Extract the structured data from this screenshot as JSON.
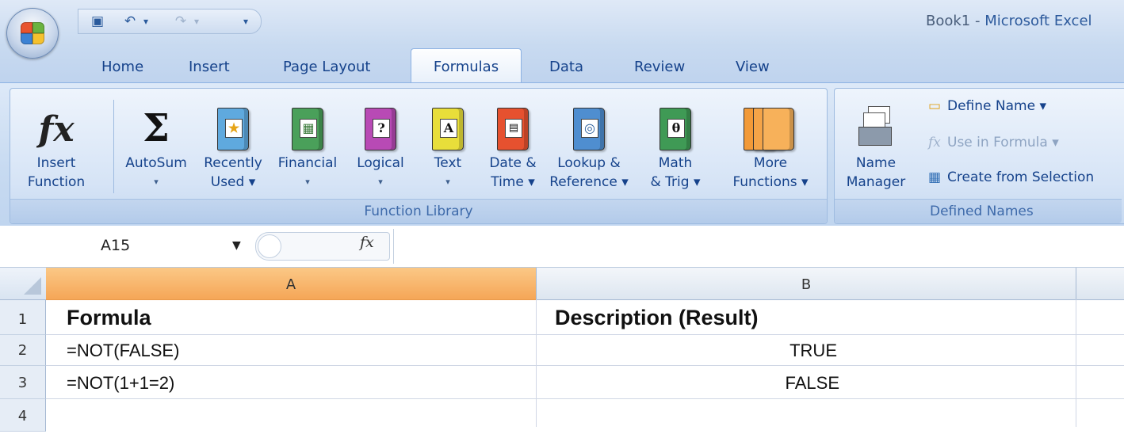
{
  "window": {
    "document": "Book1",
    "separator": " - ",
    "app": "Microsoft Excel"
  },
  "quick_access": {
    "icons": [
      "save-icon",
      "undo-icon",
      "redo-icon",
      "customize-icon"
    ],
    "glyphs": {
      "save": "▣",
      "undo": "↶",
      "undo_drop": "▾",
      "redo": "↷",
      "redo_drop": "▾",
      "customize": "₹"
    }
  },
  "tabs": [
    {
      "label": "Home"
    },
    {
      "label": "Insert"
    },
    {
      "label": "Page Layout"
    },
    {
      "label": "Formulas",
      "active": true
    },
    {
      "label": "Data"
    },
    {
      "label": "Review"
    },
    {
      "label": "View"
    }
  ],
  "ribbon": {
    "insert_function": {
      "line1": "Insert",
      "line2": "Function",
      "glyph": "fx"
    },
    "function_library": {
      "label": "Function Library",
      "autosum": {
        "line1": "AutoSum",
        "line2": "▾",
        "glyph": "Σ"
      },
      "recently_used": {
        "line1": "Recently",
        "line2": "Used ▾",
        "glyph": "★",
        "color": "#5fa9de"
      },
      "financial": {
        "line1": "Financial",
        "line2": "▾",
        "glyph": "▦",
        "color": "#4aa05a"
      },
      "logical": {
        "line1": "Logical",
        "line2": "▾",
        "glyph": "?",
        "color": "#b84ab5"
      },
      "text": {
        "line1": "Text",
        "line2": "▾",
        "glyph": "A",
        "color": "#e8de3a"
      },
      "date_time": {
        "line1": "Date &",
        "line2": "Time ▾",
        "glyph": "▤",
        "color": "#e6512f"
      },
      "lookup": {
        "line1": "Lookup &",
        "line2": "Reference ▾",
        "glyph": "◎",
        "color": "#4f8ed0"
      },
      "math": {
        "line1": "Math",
        "line2": "& Trig ▾",
        "glyph": "θ",
        "color": "#3f9a55"
      },
      "more": {
        "line1": "More",
        "line2": "Functions ▾",
        "glyph": "",
        "color": "#f29a38"
      }
    },
    "defined_names": {
      "label": "Defined Names",
      "name_manager": {
        "line1": "Name",
        "line2": "Manager"
      },
      "define_name": "Define Name ▾",
      "use_in_formula": "Use in Formula ▾",
      "create_from_selection": "Create from Selection"
    }
  },
  "formula_bar": {
    "name_box": "A15",
    "name_box_arrow": "▼",
    "fx": "fx",
    "content": ""
  },
  "grid": {
    "columns": [
      "A",
      "B"
    ],
    "rows": [
      {
        "num": "1",
        "a": "Formula",
        "b": "Description (Result)"
      },
      {
        "num": "2",
        "a": "=NOT(FALSE)",
        "b": "TRUE"
      },
      {
        "num": "3",
        "a": "=NOT(1+1=2)",
        "b": "FALSE"
      },
      {
        "num": "4",
        "a": "",
        "b": ""
      }
    ],
    "selected_column": "A",
    "active_cell": "A15"
  },
  "colors": {
    "ribbon_bg": "#c7daf1",
    "selected_column_header": "#f5a657",
    "text_blue": "#15428b"
  }
}
